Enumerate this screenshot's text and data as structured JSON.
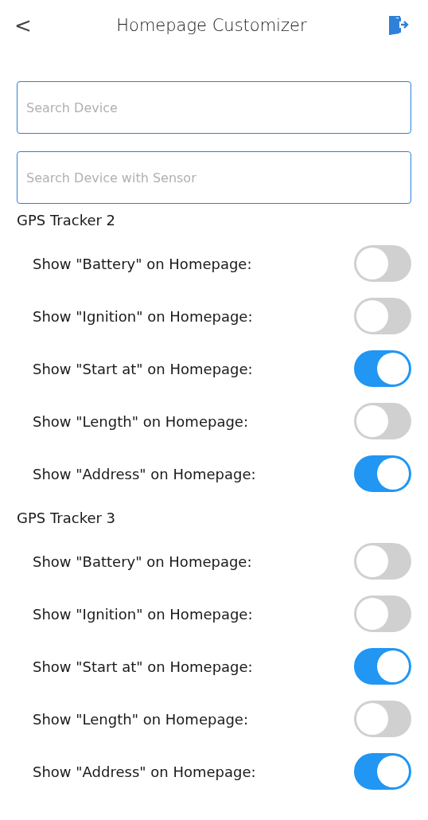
{
  "header": {
    "back": "<",
    "title": "Homepage Customizer"
  },
  "search_fields": [
    {
      "placeholder": "Search Device"
    },
    {
      "placeholder": "Search Device with Sensor"
    }
  ],
  "devices": [
    {
      "name": "GPS Tracker 2",
      "settings": [
        {
          "label": "Show \"Battery\" on Homepage:",
          "on": false
        },
        {
          "label": "Show \"Ignition\" on Homepage:",
          "on": false
        },
        {
          "label": "Show \"Start at\" on Homepage:",
          "on": true
        },
        {
          "label": "Show \"Length\" on Homepage:",
          "on": false
        },
        {
          "label": "Show \"Address\" on Homepage:",
          "on": true
        }
      ]
    },
    {
      "name": "GPS Tracker 3",
      "settings": [
        {
          "label": "Show \"Battery\" on Homepage:",
          "on": false
        },
        {
          "label": "Show \"Ignition\" on Homepage:",
          "on": false
        },
        {
          "label": "Show \"Start at\" on Homepage:",
          "on": true
        },
        {
          "label": "Show \"Length\" on Homepage:",
          "on": false
        },
        {
          "label": "Show \"Address\" on Homepage:",
          "on": true
        }
      ]
    }
  ]
}
